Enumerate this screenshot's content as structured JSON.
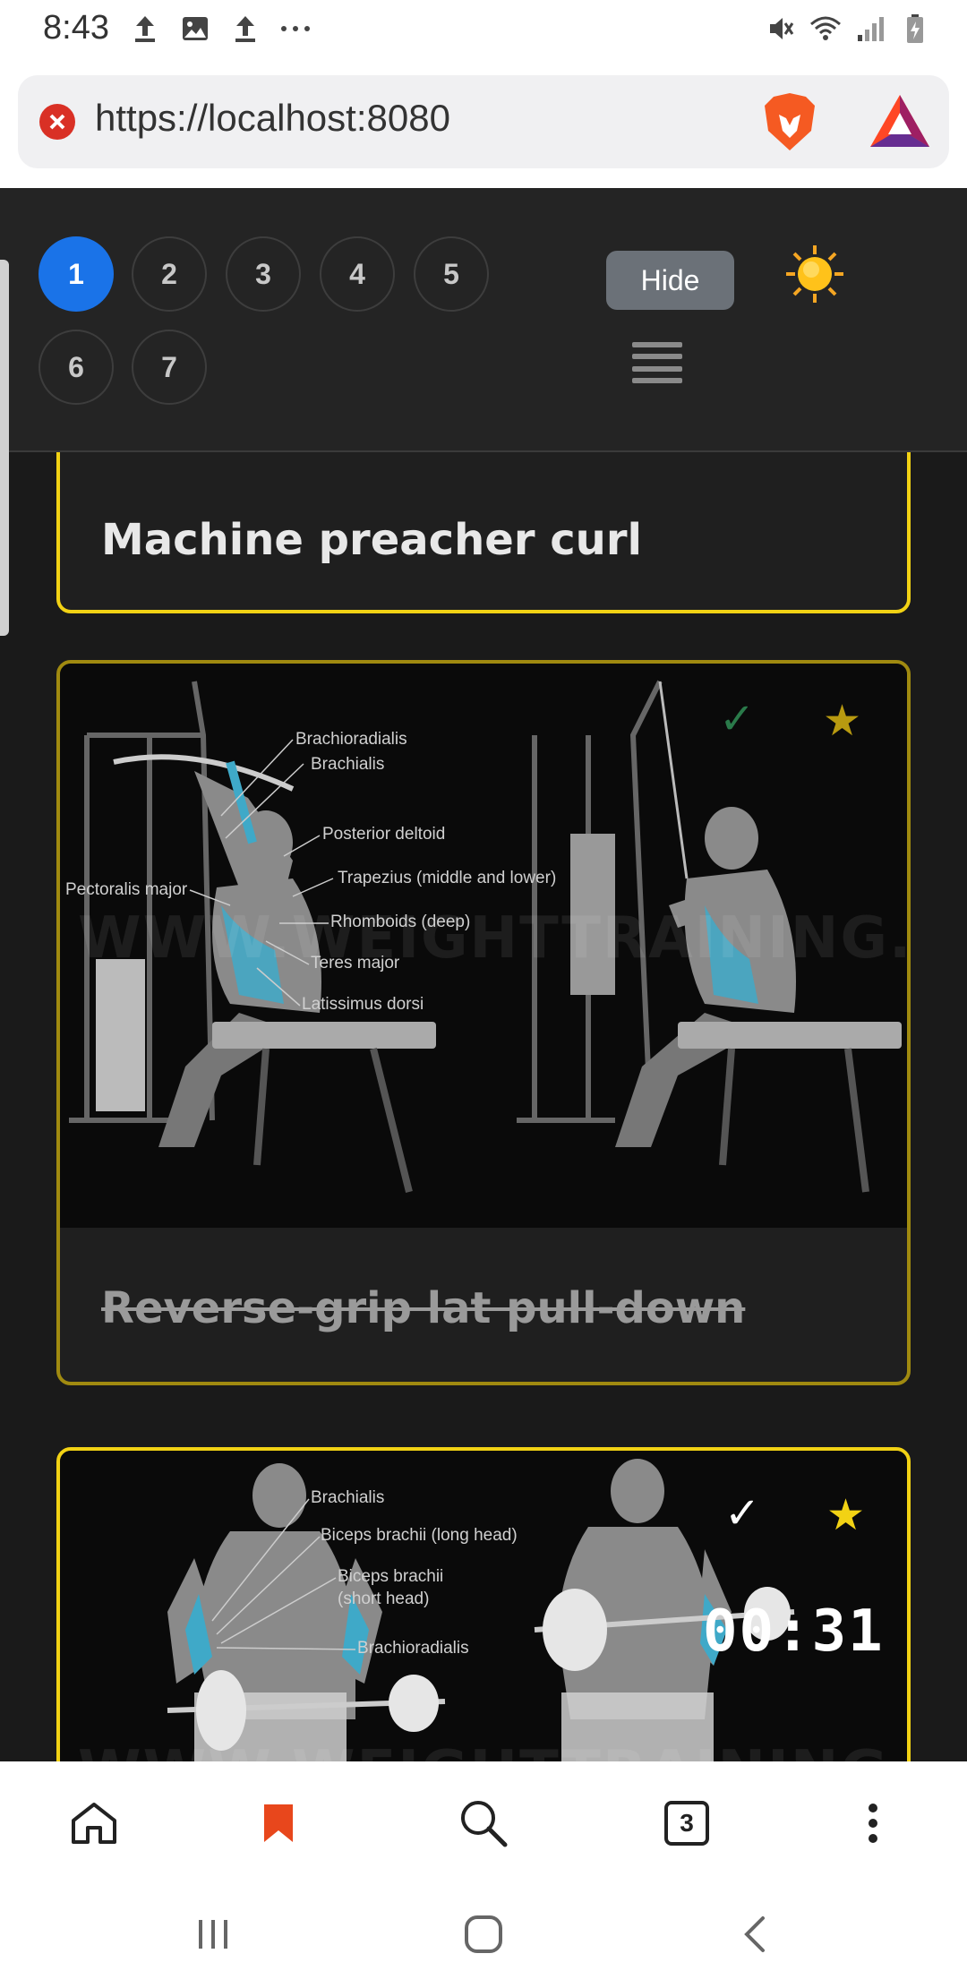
{
  "status_bar": {
    "time": "8:43"
  },
  "browser": {
    "url": "https://localhost:8080",
    "tab_count": "3"
  },
  "app": {
    "pages": [
      "1",
      "2",
      "3",
      "4",
      "5",
      "6",
      "7"
    ],
    "active_page": "1",
    "hide_label": "Hide"
  },
  "cards": [
    {
      "title": "Machine preacher curl"
    },
    {
      "title": "Reverse-grip lat pull-down",
      "annotations": [
        "Brachioradialis",
        "Brachialis",
        "Posterior deltoid",
        "Trapezius (middle and lower)",
        "Pectoralis major",
        "Rhomboids (deep)",
        "Teres major",
        "Latissimus dorsi"
      ],
      "watermark": "WWW.WEIGHTTRAINING.GUIDE",
      "check": "✓",
      "star": "★"
    },
    {
      "annotations": [
        "Brachialis",
        "Biceps brachii (long head)",
        "Biceps brachii",
        "(short head)",
        "Brachioradialis"
      ],
      "watermark": "WWW.WEIGHTTRAINING.GUIDE",
      "check": "✓",
      "star": "★",
      "timer": "00:31"
    }
  ],
  "colors": {
    "accent": "#f2d214",
    "active_page": "#1a73e8",
    "background": "#1a1a1a"
  }
}
